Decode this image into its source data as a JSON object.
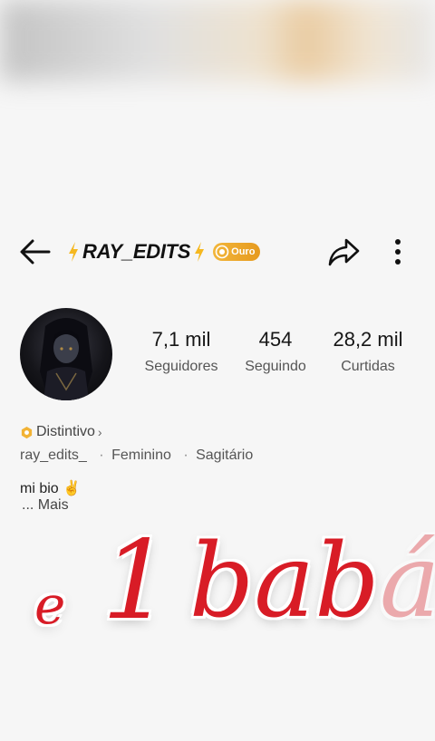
{
  "header": {
    "title": "RAY_EDITS",
    "badge_label": "Ouro"
  },
  "stats": [
    {
      "value": "7,1 mil",
      "label": "Seguidores"
    },
    {
      "value": "454",
      "label": "Seguindo"
    },
    {
      "value": "28,2 mil",
      "label": "Curtidas"
    }
  ],
  "profile": {
    "distintivo_label": "Distintivo",
    "handle": "ray_edits_",
    "gender": "Feminino",
    "sign": "Sagitário",
    "bio": "mi bio ✌️",
    "more_label": "... Mais"
  },
  "overlay": {
    "word1": "e",
    "word2": "1",
    "word3": "bab",
    "word3_fade": "á"
  },
  "colors": {
    "badge": "#e69a1f",
    "overlay_text": "#d81c26"
  }
}
